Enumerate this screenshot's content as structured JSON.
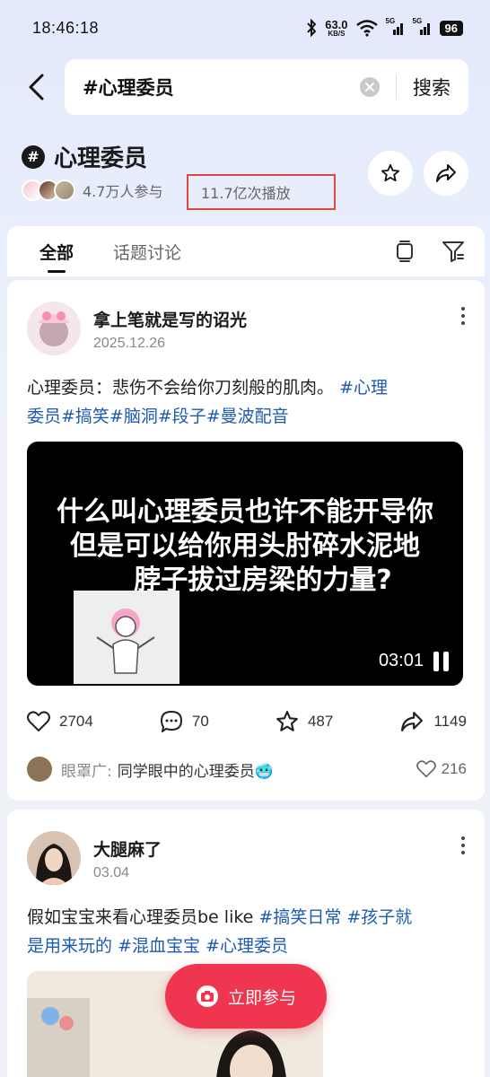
{
  "status_bar": {
    "time": "18:46:18",
    "net_speed": "63.0",
    "net_unit": "KB/S",
    "signal1_label": "5G",
    "signal2_label": "5G",
    "battery": "96"
  },
  "search": {
    "query": "#心理委员",
    "button_label": "搜索"
  },
  "topic": {
    "badge": "#",
    "title": "心理委员",
    "participants": "4.7万人参与",
    "plays": "11.7亿次播放"
  },
  "tabs": [
    {
      "label": "全部",
      "active": true
    },
    {
      "label": "话题讨论",
      "active": false
    }
  ],
  "posts": [
    {
      "author": "拿上笔就是写的诏光",
      "date": "2025.12.26",
      "text": "心理委员：悲伤不会给你刀刻般的肌肉。",
      "tags_inline": "#心理",
      "text_line2_tags": "委员#搞笑#脑洞#段子#曼波配音",
      "video": {
        "caption_line1": "什么叫心理委员也许不能开导你",
        "caption_line2": "但是可以给你用头肘碎水泥地",
        "caption_line3": "脖子拔过房梁的力量?",
        "duration": "03:01"
      },
      "stats": {
        "likes": "2704",
        "comments": "70",
        "favorites": "487",
        "shares": "1149"
      },
      "top_comment": {
        "user": "眼罩广:",
        "text": "同学眼中的心理委员🥶",
        "likes": "216"
      }
    },
    {
      "author": "大腿麻了",
      "date": "03.04",
      "text": "假如宝宝来看心理委员be like ",
      "tags_inline": "#搞笑日常 #孩子就",
      "text_line2_tags_a": "是用来玩的",
      "text_line2_tags_b": "#混血宝宝 #心理委员"
    }
  ],
  "join_button": "立即参与",
  "colors": {
    "accent_red": "#f0354f",
    "tag_blue": "#1d5bb0",
    "highlight_border": "#e0473f"
  }
}
